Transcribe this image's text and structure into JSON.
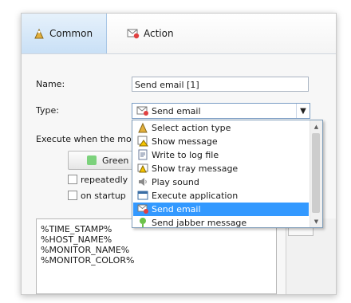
{
  "tabs": [
    {
      "label": "Common",
      "icon": "wizard-icon",
      "active": true
    },
    {
      "label": "Action",
      "icon": "email-icon",
      "active": false
    }
  ],
  "form": {
    "name_label": "Name:",
    "name_value": "Send email [1]",
    "type_label": "Type:",
    "type_value": "Send email",
    "execute_label": "Execute when the monito",
    "color_button_label": "Green",
    "color_swatch": "#7cd27c",
    "repeatedly_label": "repeatedly",
    "on_startup_label": "on startup"
  },
  "message_lines": [
    "%TIME_STAMP%",
    "%HOST_NAME%",
    "%MONITOR_NAME%",
    "%MONITOR_COLOR%"
  ],
  "dropdown": {
    "items": [
      {
        "label": "Select action type",
        "icon": "wizard-icon"
      },
      {
        "label": "Show message",
        "icon": "message-warning-icon"
      },
      {
        "label": "Write to log file",
        "icon": "log-file-icon"
      },
      {
        "label": "Show tray message",
        "icon": "tray-message-icon"
      },
      {
        "label": "Play sound",
        "icon": "speaker-icon"
      },
      {
        "label": "Execute application",
        "icon": "application-icon"
      },
      {
        "label": "Send email",
        "icon": "email-icon",
        "selected": true
      },
      {
        "label": "Send jabber message",
        "icon": "jabber-icon"
      }
    ]
  },
  "colors": {
    "selection": "#3399ff",
    "accent_tab": "#c9e0f6"
  }
}
